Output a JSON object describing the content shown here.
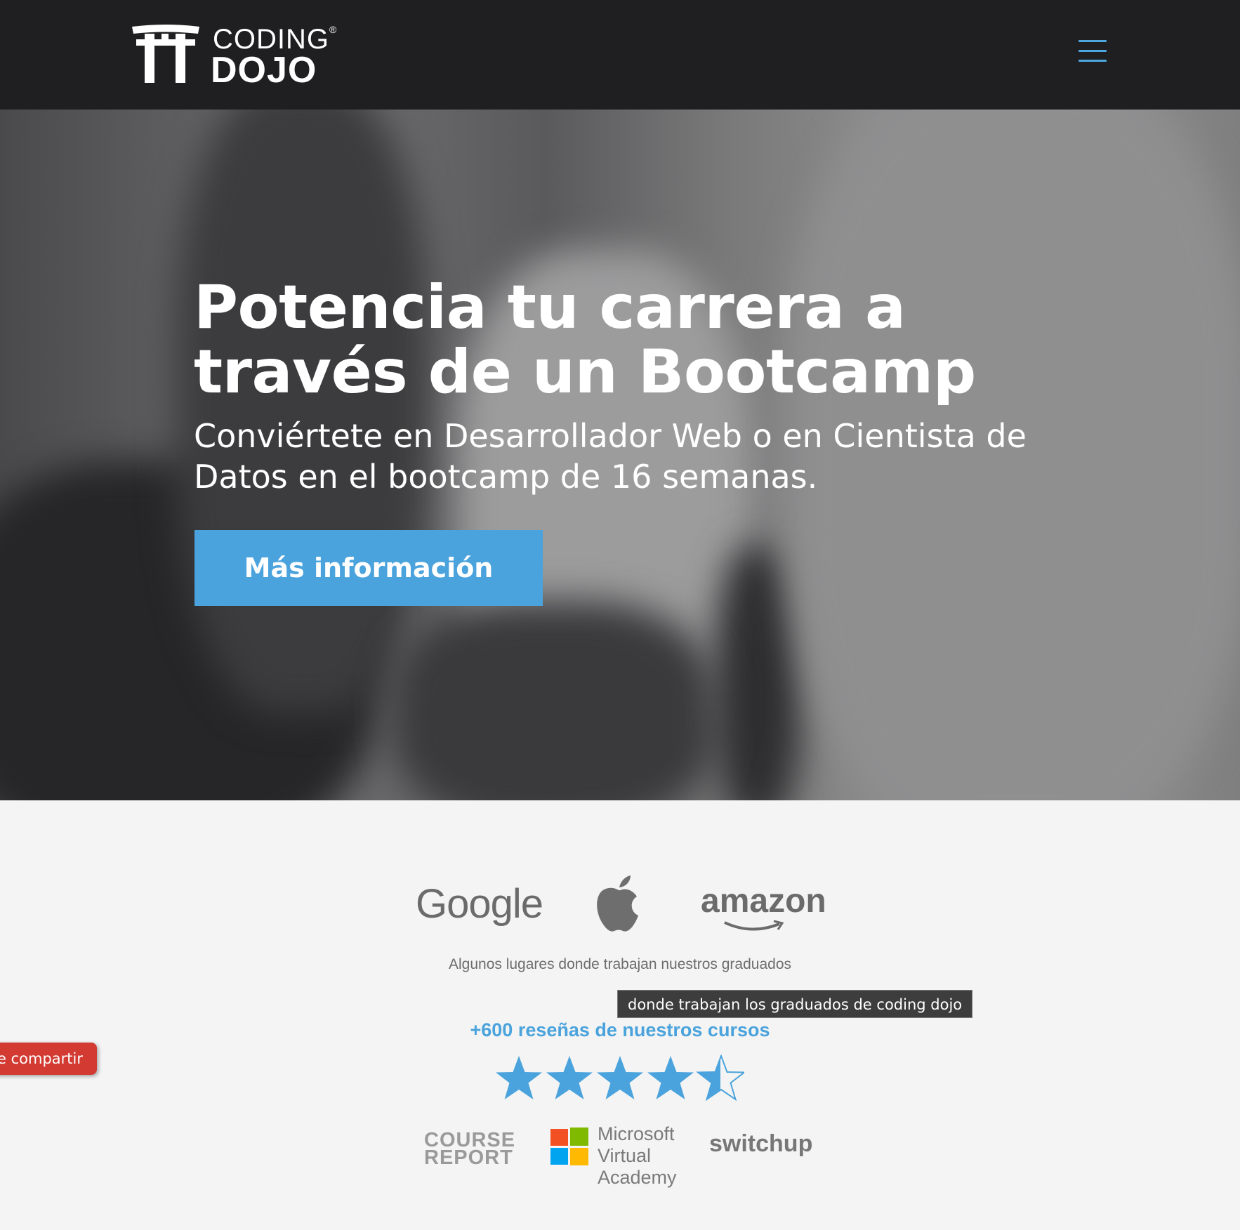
{
  "header": {
    "logo": {
      "line1": "CODING",
      "line2": "DOJO",
      "trademark": "®"
    },
    "menu_icon": "hamburger-menu-icon"
  },
  "hero": {
    "title": "Potencia tu carrera a través de un Bootcamp",
    "subtitle": "Conviértete en Desarrollador Web o en Cientista de Datos en el bootcamp de 16 semanas.",
    "cta_label": "Más información"
  },
  "employers": {
    "brands": [
      "Google",
      "amazon"
    ],
    "apple_icon": "apple-logo-icon",
    "caption": "Algunos lugares donde trabajan nuestros graduados",
    "tooltip": "donde trabajan los graduados de coding dojo"
  },
  "reviews": {
    "heading": "+600 reseñas de nuestros cursos",
    "rating": 4.5,
    "rating_max": 5,
    "sources": {
      "course_report_line1": "COURSE",
      "course_report_line2": "REPORT",
      "microsoft": [
        "Microsoft",
        "Virtual",
        "Academy"
      ],
      "switchup": "switchup"
    }
  },
  "share_tab": {
    "label": "e compartir"
  },
  "colors": {
    "accent": "#4aa3dc",
    "topbar": "#1f1f22",
    "share": "#d23a32"
  }
}
